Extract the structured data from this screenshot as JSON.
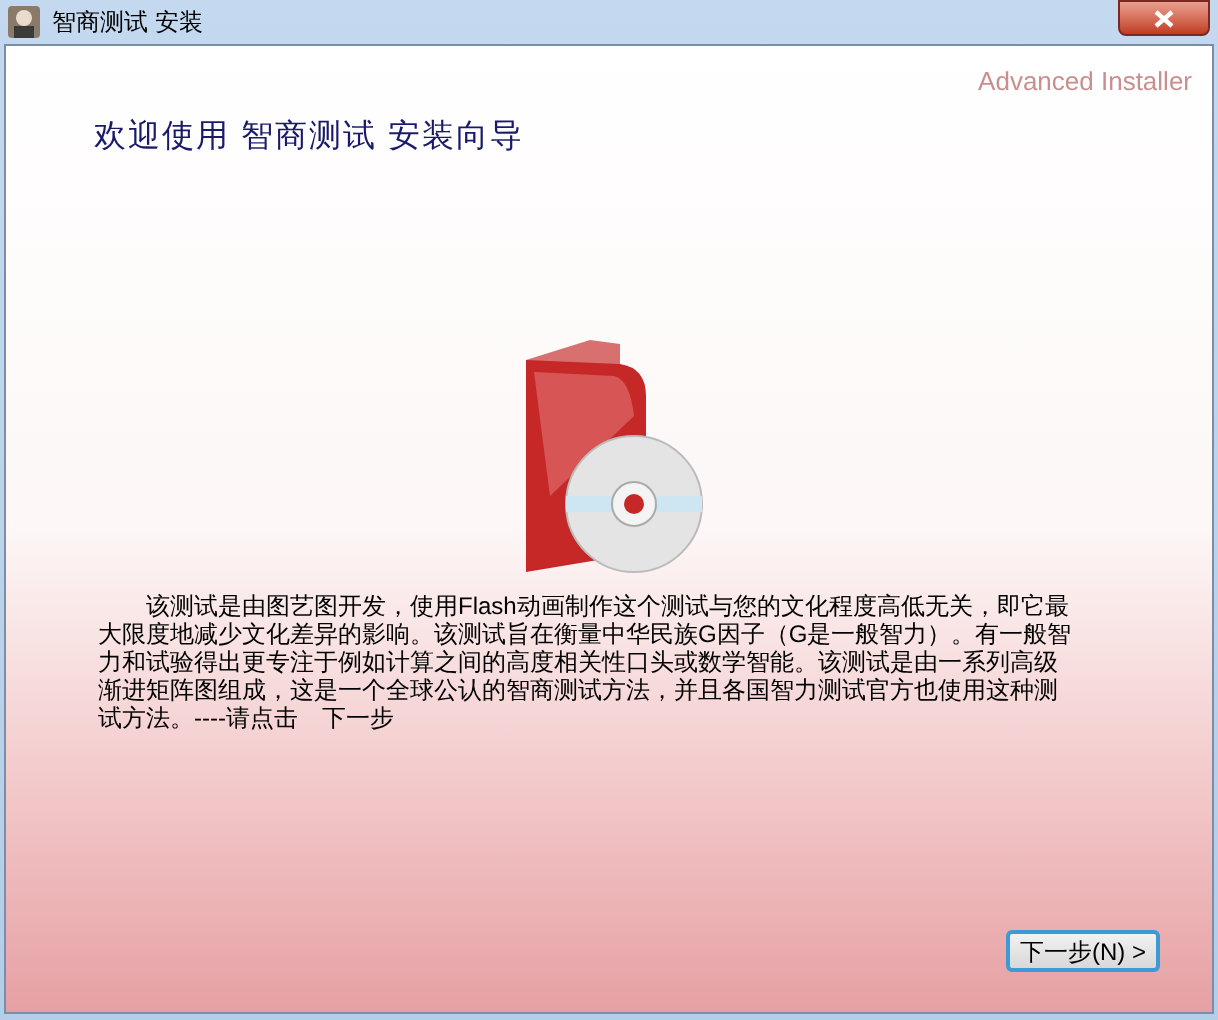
{
  "window": {
    "title": "智商测试 安装"
  },
  "brand": "Advanced Installer",
  "heading": "欢迎使用 智商测试 安装向导",
  "description": "该测试是由图艺图开发，使用Flash动画制作这个测试与您的文化程度高低无关，即它最大限度地减少文化差异的影响。该测试旨在衡量中华民族G因子（G是一般智力）。有一般智力和试验得出更专注于例如计算之间的高度相关性口头或数学智能。该测试是由一系列高级渐进矩阵图组成，这是一个全球公认的智商测试方法，并且各国智力测试官方也使用这种测试方法。----请点击　下一步",
  "buttons": [
    {
      "label": "下一步(N) >",
      "focused": true
    }
  ]
}
